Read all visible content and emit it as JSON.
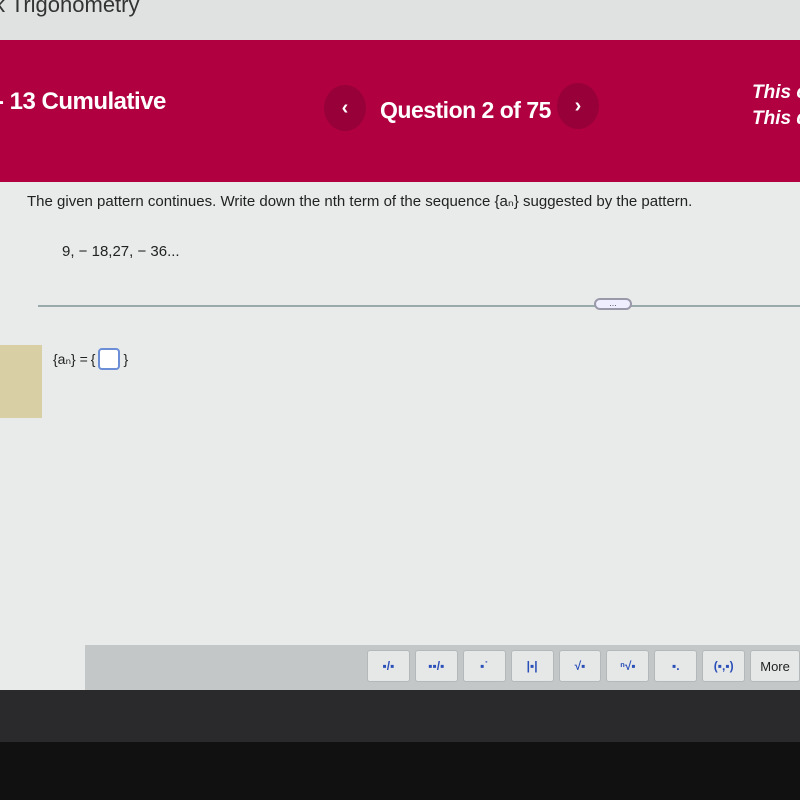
{
  "top": {
    "title": "k Trigonometry"
  },
  "banner": {
    "course": "- 13 Cumulative",
    "question_counter": "Question 2 of 75",
    "prev_icon": "chevron-left-icon",
    "next_icon": "chevron-right-icon",
    "right_line1": "This c",
    "right_line2": "This q",
    "color": "#b0003f"
  },
  "question": {
    "prompt": "The given pattern continues. Write down the nth term of the sequence {aₙ} suggested by the pattern.",
    "sequence": "9, − 18,27, − 36...",
    "answer_label": "{aₙ} =",
    "answer_open": "{",
    "answer_close": "}",
    "answer_value": ""
  },
  "toolbar": {
    "buttons": [
      "fraction",
      "mixed-number",
      "exponent",
      "absolute-value",
      "square-root",
      "nth-root",
      "subscript",
      "ordered-pair"
    ],
    "glyphs": [
      "▪/▪",
      "▪▪/▪",
      "▪˙",
      "|▪|",
      "√▪",
      "ⁿ√▪",
      "▪.",
      "(▪,▪)"
    ],
    "more_label": "More"
  }
}
